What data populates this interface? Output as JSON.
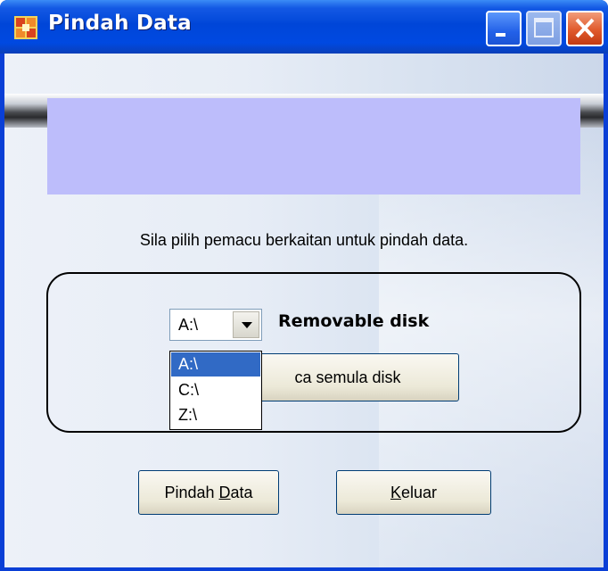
{
  "window": {
    "title": "Pindah Data",
    "controls": {
      "minimize_icon": "minimize-icon",
      "maximize_icon": "maximize-icon",
      "close_icon": "close-icon"
    }
  },
  "colors": {
    "titlebar": "#0046d8",
    "banner": "#bdbdfb",
    "selection": "#316ac5",
    "client_background": "#dfe6f3"
  },
  "instruction": "Sila pilih pemacu berkaitan untuk pindah data.",
  "drive_select": {
    "selected_value": "A:\\",
    "drive_type": "Removable disk",
    "options": [
      "A:\\",
      "C:\\",
      "Z:\\"
    ],
    "highlighted_option": "A:\\"
  },
  "buttons": {
    "reread_label": "ca semula disk",
    "move_data_prefix": "Pindah ",
    "move_data_mnemonic": "D",
    "move_data_suffix": "ata",
    "exit_mnemonic": "K",
    "exit_suffix": "eluar"
  }
}
